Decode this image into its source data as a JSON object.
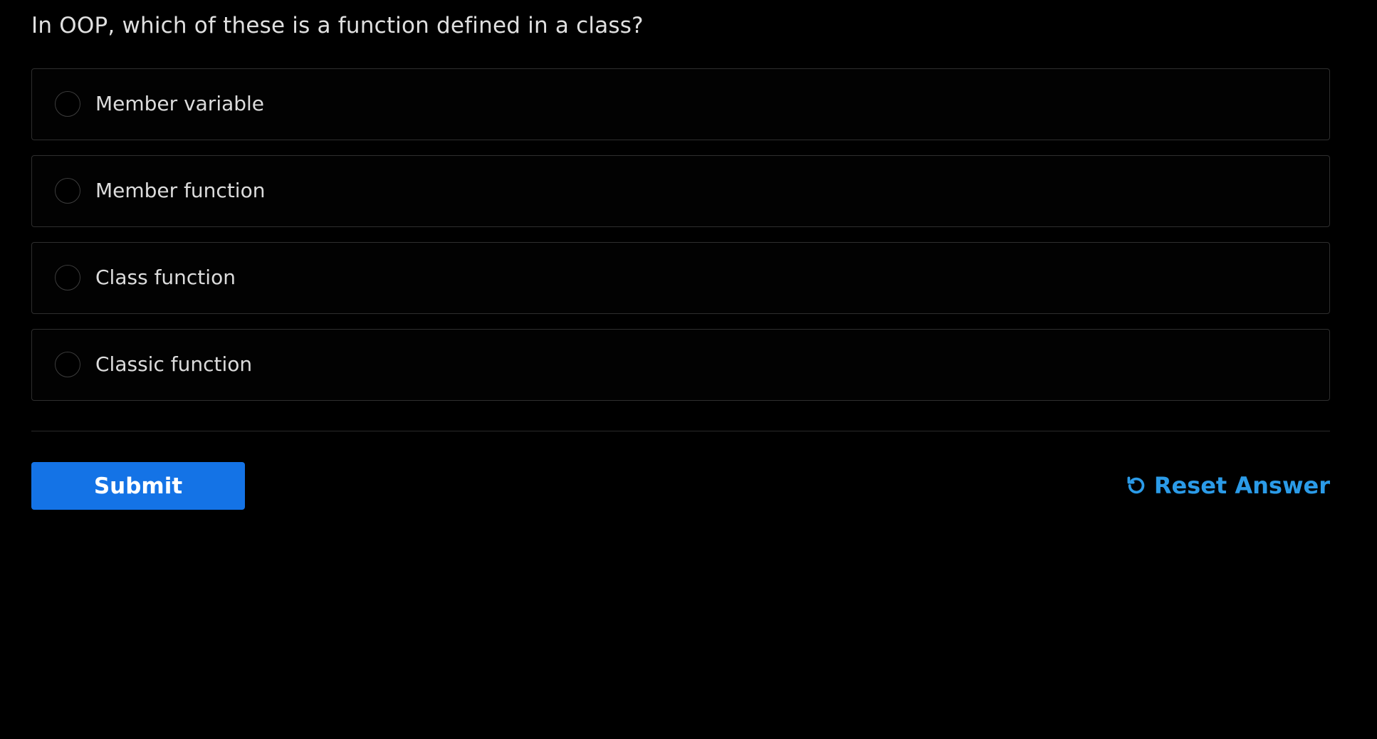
{
  "quiz": {
    "question": "In OOP, which of these is a function defined in a class?",
    "options": [
      {
        "label": "Member variable",
        "selected": false
      },
      {
        "label": "Member function",
        "selected": false
      },
      {
        "label": "Class function",
        "selected": false
      },
      {
        "label": "Classic function",
        "selected": false
      }
    ],
    "submit_label": "Submit",
    "reset_label": "Reset Answer",
    "reset_icon": "reset-icon"
  },
  "colors": {
    "background": "#000000",
    "primary_button": "#1473e6",
    "link_accent": "#2b9be8",
    "option_border": "#2e2e2e"
  }
}
